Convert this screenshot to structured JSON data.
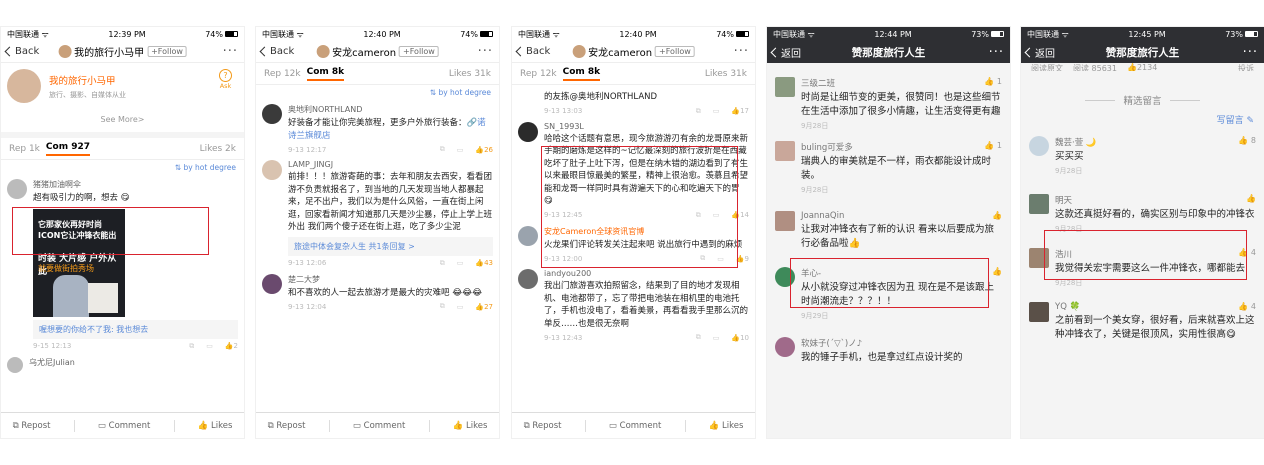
{
  "screens": [
    {
      "status": {
        "carrier": "中国联通",
        "time": "12:39 PM",
        "battery": "74%"
      },
      "nav": {
        "back": "Back",
        "user": "我的旅行小马甲",
        "follow": "+Follow",
        "more": "···"
      },
      "profile": {
        "name": "我的旅行小马甲",
        "desc": "旅行、摄影、自媒体从业",
        "ask_icon": "?",
        "ask": "Ask",
        "seemore": "See More>"
      },
      "tabs": {
        "rep": "Rep 1k",
        "com": "Com 927",
        "likes": "Likes 2k"
      },
      "sort": "by hot degree",
      "comments": [
        {
          "name": "猪猪加油啊伞",
          "text": "超有吸引力的啊，想去",
          "ad": {
            "t1": "它那家伙再好时尚ICON它让冲锋衣能出",
            "t2": "时装 大片感 户外从此",
            "t3": "就要做街拍秀场"
          },
          "reply": "喔想要的你给不了我: 我也想去",
          "time": "9-15 12:13",
          "likes": "2"
        },
        {
          "name": "乌尤尼Julian"
        }
      ],
      "bottom": {
        "repost": "Repost",
        "comment": "Comment",
        "likes": "Likes"
      }
    },
    {
      "status": {
        "carrier": "中国联通",
        "time": "12:40 PM",
        "battery": "74%"
      },
      "nav": {
        "back": "Back",
        "user": "安龙cameron",
        "follow": "+Follow",
        "more": "···"
      },
      "tabs": {
        "rep": "Rep 12k",
        "com": "Com 8k",
        "likes": "Likes 31k"
      },
      "sort": "by hot degree",
      "comments": [
        {
          "name": "奥地利NORTHLAND",
          "text": "好装备才能让你完美旅程，更多户外旅行装备：",
          "link": "诺诗兰旗舰店",
          "time": "9-13 12:17",
          "likes": "26",
          "hot": true
        },
        {
          "name": "LAMP_JINGJ",
          "text": "前排！！！旅游寄葩的事：去年和朋友去西安，看看团游不负责就报名了，到当地的几天发现当地人都暴起来，足不出户，我们以为是什么风俗，一直在街上闲逛，回家看新闻才知道那几天是沙尘暴，停止上学上班外出 我们两个傻子还在街上逛，吃了多少尘泥",
          "reply": "旅途中体会复杂人生  共1条回复 >",
          "time": "9-13 12:06",
          "likes": "43",
          "hot": true
        },
        {
          "name": "楚二大梦",
          "text": "和不喜欢的人一起去旅游才是最大的灾难吧",
          "time": "9-13 12:04",
          "likes": "27",
          "hot": true
        }
      ],
      "bottom": {
        "repost": "Repost",
        "comment": "Comment",
        "likes": "Likes"
      }
    },
    {
      "status": {
        "carrier": "中国联通",
        "time": "12:40 PM",
        "battery": "74%"
      },
      "nav": {
        "back": "Back",
        "user": "安龙cameron",
        "follow": "+Follow",
        "more": "···"
      },
      "tabs": {
        "rep": "Rep 12k",
        "com": "Com 8k",
        "likes": "Likes 31k"
      },
      "comments": [
        {
          "name": "",
          "text": "的友拣@奥地利NORTHLAND",
          "time": "9-13 13:03",
          "likes": "17"
        },
        {
          "name": "SN_1993L",
          "text": "哈哈这个话题有意思，现今旅游游刃有余的龙哥原来新手期的磨炼是这样的~记忆最深刻的旅行波折是在西藏吃坏了肚子上吐下泻，但是在纳木错的湖边看到了有生以来最眼目惊最美的繁星，精神上很治愈。羡慕且希望能和龙哥一样同时具有游遍天下的心和吃遍天下的胃",
          "time": "9-13 12:45",
          "likes": "14"
        },
        {
          "name": "安龙Cameron全球资讯官博",
          "text": "火龙果们评论转发关注起来吧 说出旅行中遇到的麻烦",
          "time": "9-13 12:00",
          "likes": "9"
        },
        {
          "name": "iandyou200",
          "text": "我出门旅游喜欢拍照留念，结果到了目的地才发现相机、电池都带了，忘了带把电池装在相机里的电池托了，手机也没电了，看着美景，再看看我手里那么沉的单反……也是很无奈啊",
          "time": "9-13 12:43",
          "likes": "10"
        }
      ],
      "bottom": {
        "repost": "Repost",
        "comment": "Comment",
        "likes": "Likes"
      }
    },
    {
      "status": {
        "carrier": "中国联通",
        "time": "12:44 PM",
        "battery": "73%"
      },
      "nav": {
        "back": "返回",
        "title": "赞那度旅行人生",
        "more": "···"
      },
      "comments": [
        {
          "name": "三级二班",
          "likes": "1",
          "text": "时尚是让细节变的更美，很赞同！也是这些细节在生活中添加了很多小情趣，让生活变得更有趣",
          "date": "9月28日"
        },
        {
          "name": "buling可爱多",
          "likes": "1",
          "text": "瑞典人的审美就是不一样，雨衣都能设计成时装。",
          "date": "9月28日"
        },
        {
          "name": "JoannaQin",
          "likes": "",
          "text": "让我对冲锋衣有了新的认识 看来以后要成为旅行必备品啦",
          "date": ""
        },
        {
          "name": "羊心-",
          "likes": "",
          "text": "从小就没穿过冲锋衣因为丑 现在是不是该跟上时尚潮流走？？？！！",
          "date": "9月29日"
        },
        {
          "name": "软妹子(ˊ▽ˋ)ノ♪",
          "likes": "",
          "text": "我的锤子手机，也是拿过红点设计奖的",
          "date": ""
        }
      ]
    },
    {
      "status": {
        "carrier": "中国联通",
        "time": "12:45 PM",
        "battery": "73%"
      },
      "nav": {
        "back": "返回",
        "title": "赞那度旅行人生",
        "more": "···"
      },
      "readrow": {
        "orig": "阅读原文",
        "reads": "阅读 85631",
        "likes": "2134",
        "report": "投诉"
      },
      "selected": "精选留言",
      "write": "写留言",
      "comments": [
        {
          "name": "魏芸·萱",
          "likes": "8",
          "text": "买买买",
          "date": "9月28日"
        },
        {
          "name": "明天",
          "likes": "",
          "text": "这款还真挺好看的，确实区别与印象中的冲锋衣",
          "date": "9月28日"
        },
        {
          "name": "浩川",
          "likes": "4",
          "text": "我觉得关宏宇需要这么一件冲锋衣，哪都能去",
          "date": "9月28日"
        },
        {
          "name": "YQ",
          "likes": "4",
          "text": "之前看到一个美女穿，很好看，后来就喜欢上这种冲锋衣了，关键是很顶风，实用性很高",
          "date": ""
        }
      ]
    }
  ]
}
